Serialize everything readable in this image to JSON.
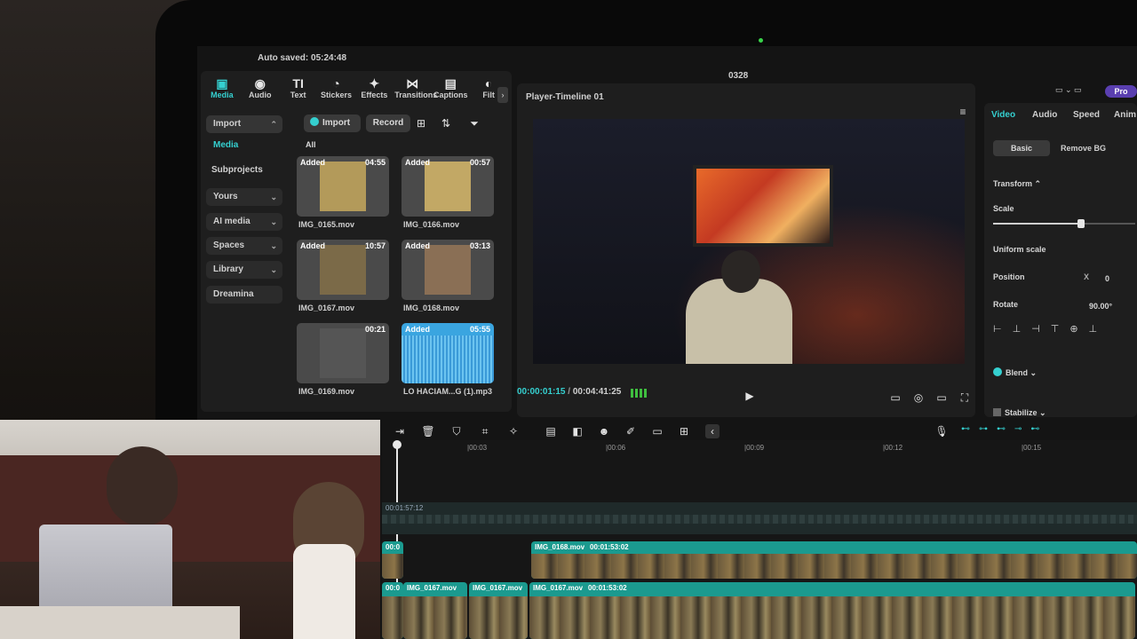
{
  "status": {
    "autosave": "Auto saved: 05:24:48",
    "project_name": "0328"
  },
  "toolbar": [
    {
      "label": "Media",
      "icon": "media-icon",
      "glyph": "▣",
      "active": true
    },
    {
      "label": "Audio",
      "icon": "audio-icon",
      "glyph": "◉",
      "active": false
    },
    {
      "label": "Text",
      "icon": "text-icon",
      "glyph": "TI",
      "active": false
    },
    {
      "label": "Stickers",
      "icon": "stickers-icon",
      "glyph": "◔",
      "active": false
    },
    {
      "label": "Effects",
      "icon": "effects-icon",
      "glyph": "✦",
      "active": false
    },
    {
      "label": "Transitions",
      "icon": "transitions-icon",
      "glyph": "⋈",
      "active": false
    },
    {
      "label": "Captions",
      "icon": "captions-icon",
      "glyph": "▤",
      "active": false
    },
    {
      "label": "Filt",
      "icon": "filters-icon",
      "glyph": "◐",
      "active": false
    }
  ],
  "sidebar": {
    "import": "Import",
    "media": "Media",
    "subprojects": "Subprojects",
    "yours": "Yours",
    "ai_media": "AI media",
    "spaces": "Spaces",
    "library": "Library",
    "dreamina": "Dreamina"
  },
  "media_panel": {
    "import_button": "Import",
    "record_button": "Record",
    "filter_all": "All",
    "items": [
      {
        "name": "IMG_0165.mov",
        "badge": "Added",
        "duration": "04:55",
        "tone": "#b39a5a"
      },
      {
        "name": "IMG_0166.mov",
        "badge": "Added",
        "duration": "00:57",
        "tone": "#c2a865"
      },
      {
        "name": "IMG_0167.mov",
        "badge": "Added",
        "duration": "10:57",
        "tone": "#7b6a48"
      },
      {
        "name": "IMG_0168.mov",
        "badge": "Added",
        "duration": "03:13",
        "tone": "#8a6f55"
      },
      {
        "name": "IMG_0169.mov",
        "badge": "",
        "duration": "00:21",
        "tone": "#555555"
      },
      {
        "name": "LO HACIAM...G (1).mp3",
        "badge": "Added",
        "duration": "05:55",
        "tone": "#3aa5e0"
      }
    ]
  },
  "player": {
    "title": "Player-Timeline 01",
    "current_time": "00:00:01:15",
    "total_time": "00:04:41:25"
  },
  "inspector": {
    "tabs": [
      "Video",
      "Audio",
      "Speed",
      "Anim"
    ],
    "subtabs": [
      "Basic",
      "Remove BG"
    ],
    "transform": "Transform",
    "scale_label": "Scale",
    "scale_value": 0.62,
    "uniform_scale": "Uniform scale",
    "position_label": "Position",
    "position_x_label": "X",
    "position_x": "0",
    "rotate_label": "Rotate",
    "rotate_value": "90.00°",
    "blend": "Blend",
    "stabilize": "Stabilize",
    "pro_badge": "Pro"
  },
  "timeline": {
    "ruler": [
      "00:03",
      "00:06",
      "00:09",
      "00:12",
      "00:15"
    ],
    "audio_time": "00:01:57:12",
    "clips_upper": [
      {
        "label": "IMG_0168.mov",
        "duration": "00:01:53:02"
      }
    ],
    "upper_left_label": "00:0",
    "clips_lower": [
      {
        "label": "IMG_0167.mov",
        "duration": ""
      },
      {
        "label": "IMG_0167.mov",
        "duration": ""
      },
      {
        "label": "IMG_0167.mov",
        "duration": "00:01:53:02"
      }
    ],
    "lower_left_label": "00:0"
  }
}
